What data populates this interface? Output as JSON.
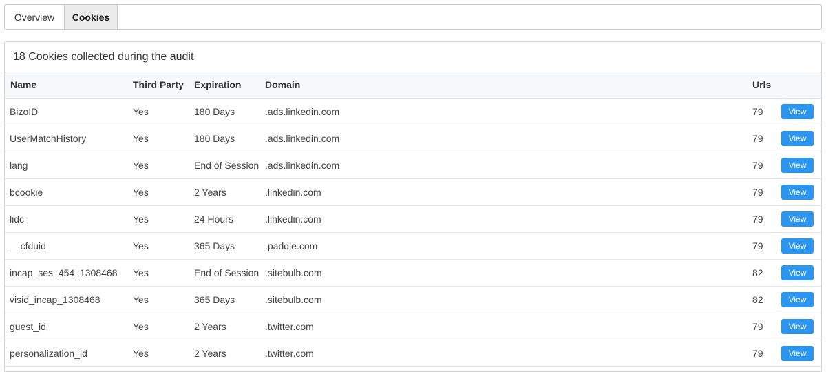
{
  "tabs": [
    {
      "label": "Overview",
      "active": false
    },
    {
      "label": "Cookies",
      "active": true
    }
  ],
  "panel": {
    "title": "18 Cookies collected during the audit"
  },
  "table": {
    "columns": [
      "Name",
      "Third Party",
      "Expiration",
      "Domain",
      "Urls"
    ],
    "view_label": "View",
    "rows": [
      {
        "name": "BizoID",
        "third_party": "Yes",
        "expiration": "180 Days",
        "domain": ".ads.linkedin.com",
        "urls": "79"
      },
      {
        "name": "UserMatchHistory",
        "third_party": "Yes",
        "expiration": "180 Days",
        "domain": ".ads.linkedin.com",
        "urls": "79"
      },
      {
        "name": "lang",
        "third_party": "Yes",
        "expiration": "End of Session",
        "domain": ".ads.linkedin.com",
        "urls": "79"
      },
      {
        "name": "bcookie",
        "third_party": "Yes",
        "expiration": "2 Years",
        "domain": ".linkedin.com",
        "urls": "79"
      },
      {
        "name": "lidc",
        "third_party": "Yes",
        "expiration": "24 Hours",
        "domain": ".linkedin.com",
        "urls": "79"
      },
      {
        "name": "__cfduid",
        "third_party": "Yes",
        "expiration": "365 Days",
        "domain": ".paddle.com",
        "urls": "79"
      },
      {
        "name": "incap_ses_454_1308468",
        "third_party": "Yes",
        "expiration": "End of Session",
        "domain": ".sitebulb.com",
        "urls": "82"
      },
      {
        "name": "visid_incap_1308468",
        "third_party": "Yes",
        "expiration": "365 Days",
        "domain": ".sitebulb.com",
        "urls": "82"
      },
      {
        "name": "guest_id",
        "third_party": "Yes",
        "expiration": "2 Years",
        "domain": ".twitter.com",
        "urls": "79"
      },
      {
        "name": "personalization_id",
        "third_party": "Yes",
        "expiration": "2 Years",
        "domain": ".twitter.com",
        "urls": "79"
      }
    ]
  },
  "colors": {
    "button": "#2b95f0",
    "active_tab": "#ececec",
    "header_bg": "#f7f8fa"
  }
}
